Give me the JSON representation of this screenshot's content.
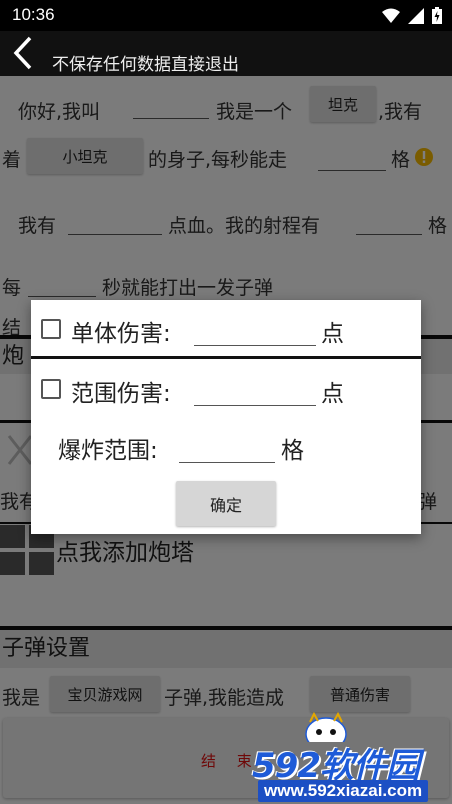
{
  "status_bar": {
    "time": "10:36"
  },
  "app_bar": {
    "title": "不保存任何数据直接退出"
  },
  "form": {
    "intro_prefix": "你好,我叫",
    "intro_middle": "我是一个",
    "type_chip": "坦克",
    "intro_suffix": ",我有",
    "have_prefix": "着",
    "body_chip": "小坦克",
    "body_suffix": "的身子,每秒能走",
    "grid_unit": "格",
    "hp_prefix": "我有",
    "hp_middle": "点血。我的射程有",
    "hp_suffix": "格",
    "fire_prefix": "每",
    "fire_suffix": "秒就能打出一发子弹",
    "finish_partial": "结"
  },
  "turret_section": {
    "header_partial": "炮",
    "row_partial_left": "我有",
    "row_partial_right": "弹",
    "add_label": "点我添加炮塔"
  },
  "bullet_section": {
    "header": "子弹设置",
    "row_prefix": "我是",
    "bullet_chip": "宝贝游戏网",
    "row_middle": "子弹,我能造成",
    "damage_chip": "普通伤害",
    "finish_button": "结 束"
  },
  "dialog": {
    "single_damage_label": "单体伤害:",
    "single_damage_unit": "点",
    "area_damage_label": "范围伤害:",
    "area_damage_unit": "点",
    "blast_range_label": "爆炸范围:",
    "blast_range_unit": "格",
    "confirm": "确定"
  },
  "watermark": {
    "brand": "592软件园",
    "url": "www.592xiazai.com"
  },
  "colors": {
    "warning": "#f5b800",
    "brand_blue": "#1e5bd8"
  }
}
